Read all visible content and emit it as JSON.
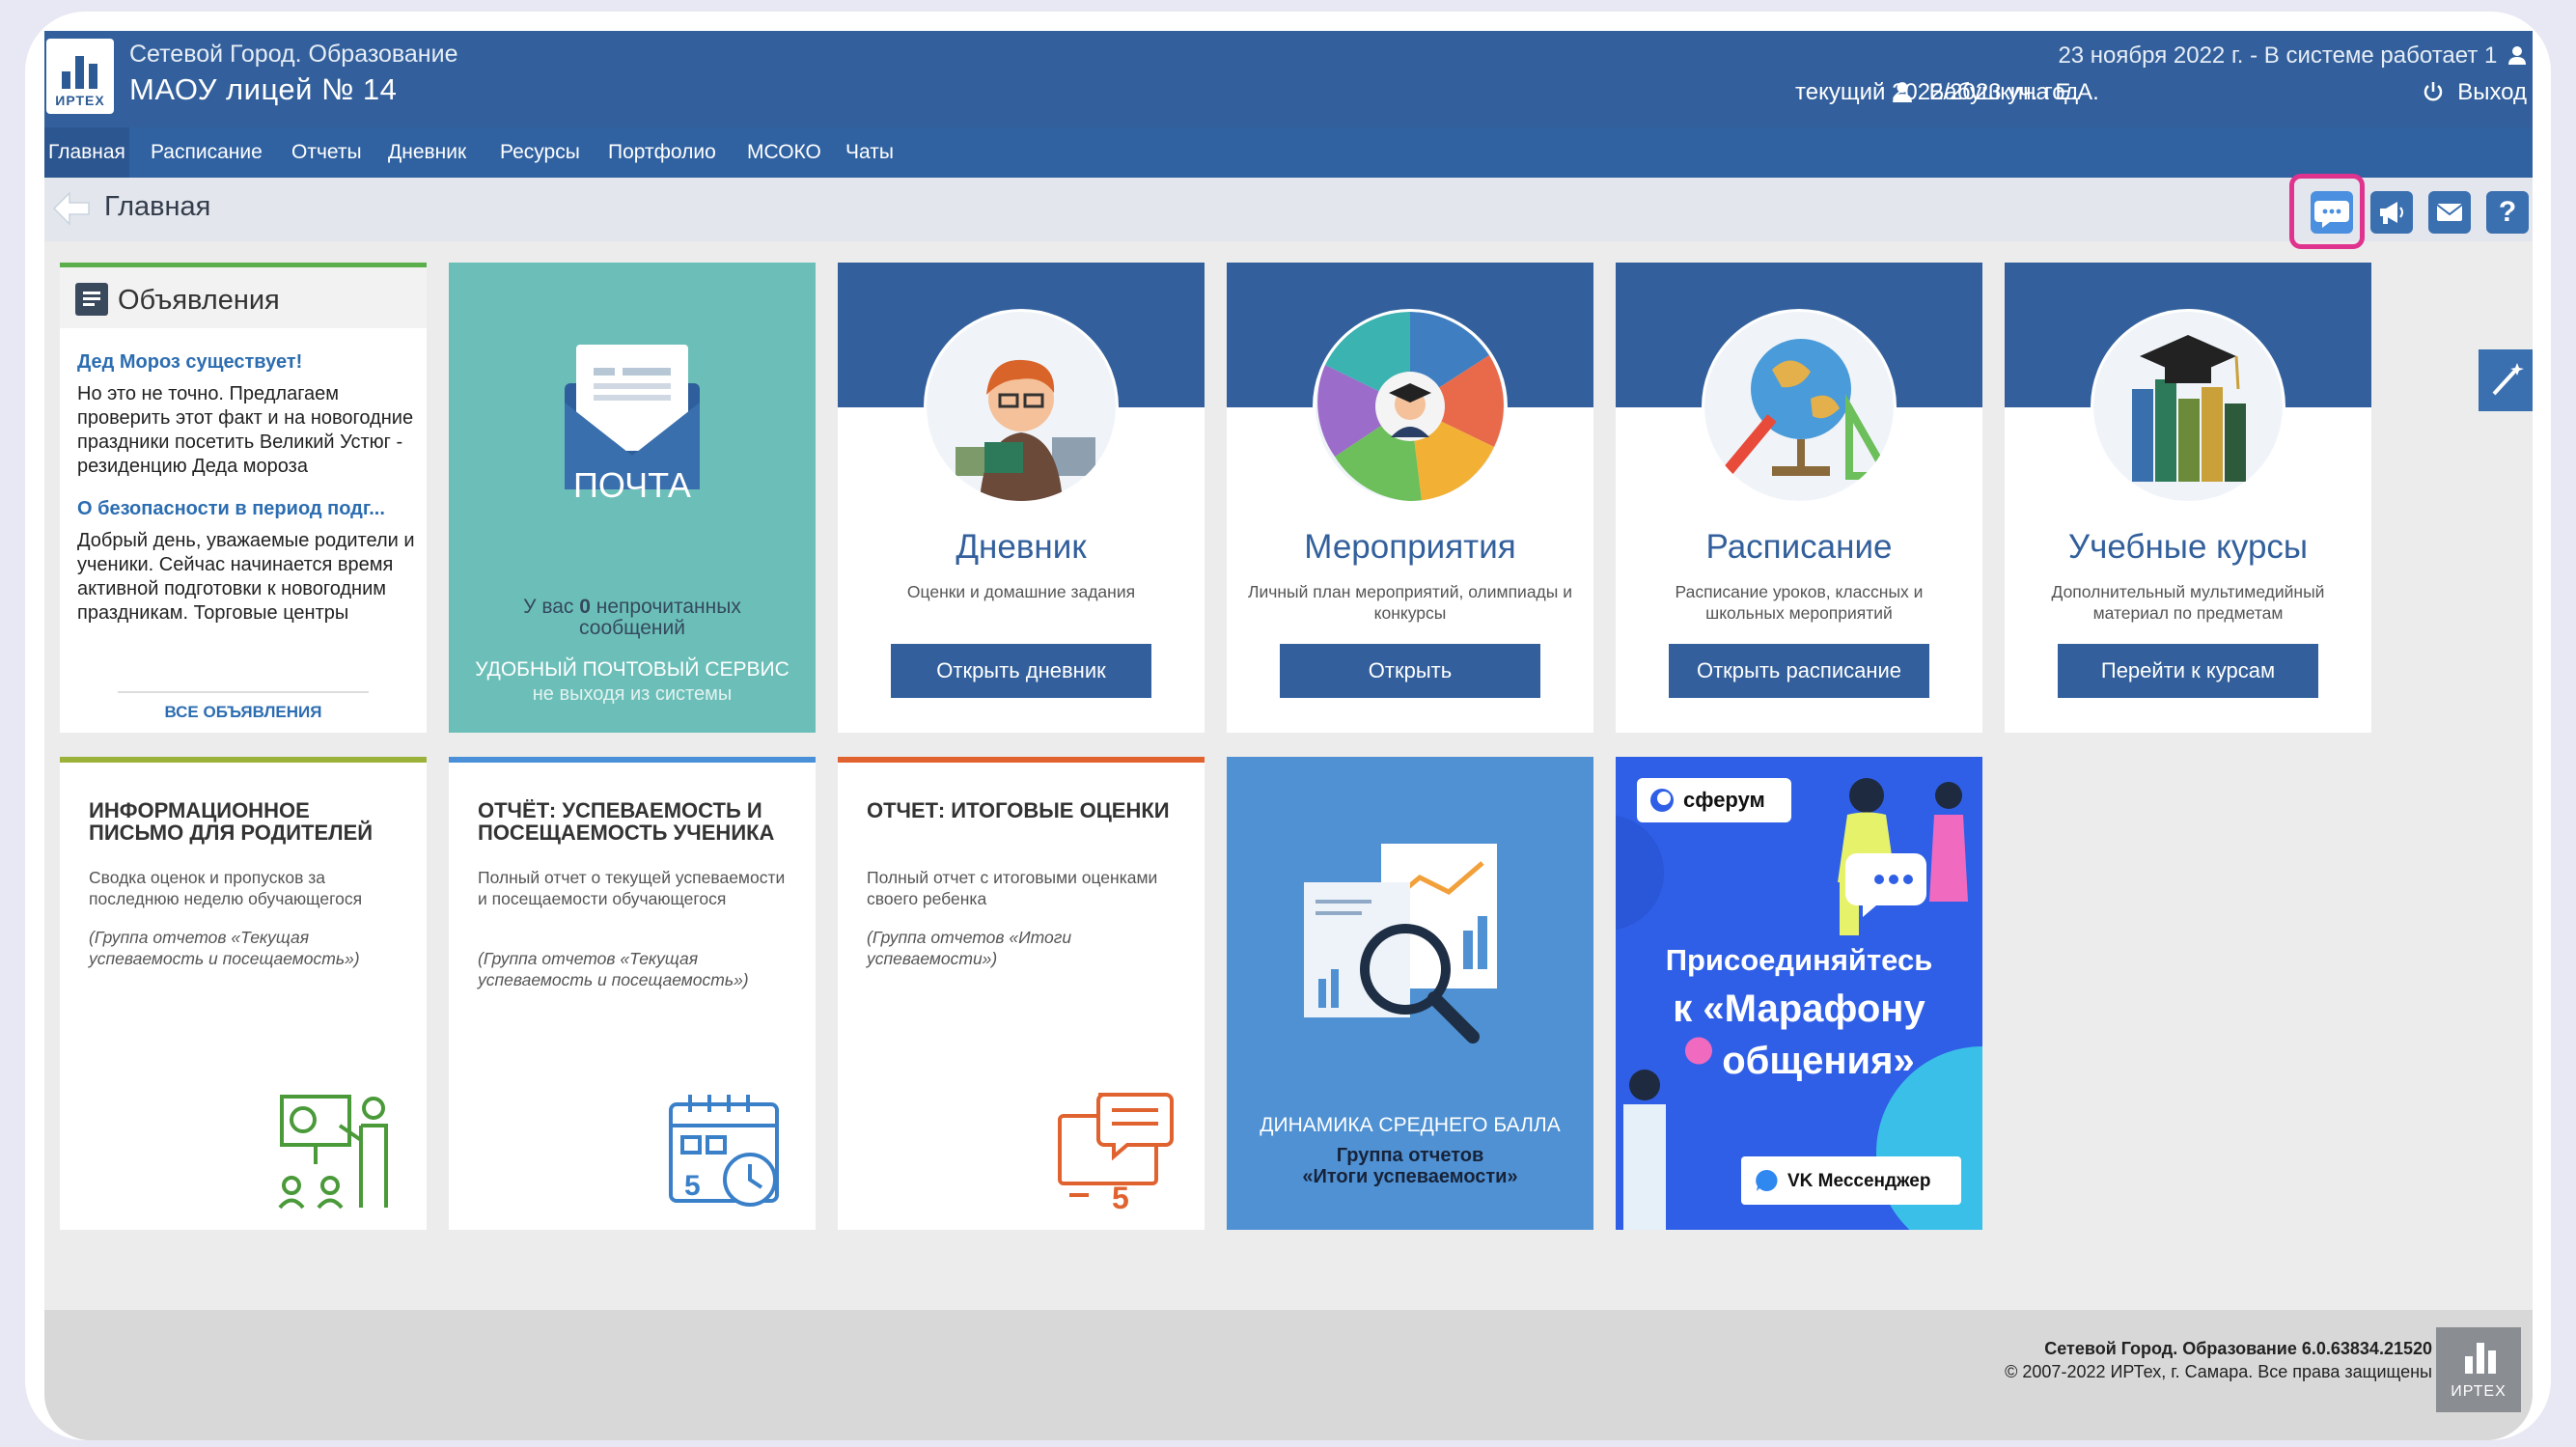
{
  "header": {
    "logo_caption": "ИРТЕХ",
    "subtitle": "Сетевой Город. Образование",
    "org_name": "МАОУ лицей № 14",
    "date_status": "23 ноября 2022 г. - В системе работает 1",
    "school_year": "текущий 2022/2023 уч. год",
    "user_name": "Бабушкина Е.А.",
    "exit_label": "Выход"
  },
  "nav": {
    "items": [
      {
        "label": "Главная",
        "active": true
      },
      {
        "label": "Расписание"
      },
      {
        "label": "Отчеты"
      },
      {
        "label": "Дневник"
      },
      {
        "label": "Ресурсы"
      },
      {
        "label": "Портфолио"
      },
      {
        "label": "МСОКО"
      },
      {
        "label": "Чаты"
      }
    ]
  },
  "breadcrumb": {
    "title": "Главная"
  },
  "toolbar": {
    "buttons": [
      {
        "name": "chat-icon",
        "highlighted": true
      },
      {
        "name": "megaphone-icon"
      },
      {
        "name": "mail-icon"
      },
      {
        "name": "help-icon",
        "label": "?"
      }
    ]
  },
  "ads": {
    "title": "Объявления",
    "items": [
      {
        "title": "Дед Мороз существует!",
        "text": "Но это не точно. Предлагаем проверить этот факт и на новогодние праздники посетить Великий Устюг - резиденцию Деда мороза"
      },
      {
        "title": "О безопасности в период подг...",
        "text": "Добрый день, уважаемые родители и ученики. Сейчас начинается время активной подготовки к новогодним праздникам. Торговые центры"
      }
    ],
    "all_link": "ВСЕ ОБЪЯВЛЕНИЯ"
  },
  "mail": {
    "envelope_label": "ПОЧТА",
    "unread_prefix": "У вас ",
    "unread_count": "0",
    "unread_suffix": " непрочитанных",
    "unread_line2": "сообщений",
    "service_title": "УДОБНЫЙ ПОЧТОВЫЙ СЕРВИС",
    "service_sub": "не выходя из системы",
    "colors": {
      "bg": "#6cbfb8"
    }
  },
  "tiles": [
    {
      "title": "Дневник",
      "desc": "Оценки и домашние задания",
      "button": "Открыть дневник"
    },
    {
      "title": "Мероприятия",
      "desc": "Личный план мероприятий, олимпиады и конкурсы",
      "button": "Открыть"
    },
    {
      "title": "Расписание",
      "desc": "Расписание уроков, классных и школьных мероприятий",
      "button": "Открыть расписание"
    },
    {
      "title": "Учебные курсы",
      "desc": "Дополнительный мультимедийный материал по предметам",
      "button": "Перейти к курсам"
    }
  ],
  "reports": [
    {
      "title": "ИНФОРМАЦИОННОЕ ПИСЬМО ДЛЯ РОДИТЕЛЕЙ",
      "desc": "Сводка оценок и пропусков за последнюю неделю обучающегося",
      "group": "(Группа отчетов «Текущая успеваемость и посещаемость»)",
      "color": "#9bb23a"
    },
    {
      "title": "ОТЧЁТ: УСПЕВАЕМОСТЬ И ПОСЕЩАЕМОСТЬ УЧЕНИКА",
      "desc": "Полный отчет о текущей успеваемости и посещаемости обучающегося",
      "group": "(Группа отчетов «Текущая успеваемость и посещаемость»)",
      "color": "#4a90d9"
    },
    {
      "title": "ОТЧЕТ: ИТОГОВЫЕ ОЦЕНКИ",
      "desc": "Полный отчет с итоговыми оценками своего ребенка",
      "group": "(Группа отчетов «Итоги успеваемости»)",
      "color": "#e0622f"
    }
  ],
  "dynamics": {
    "title": "ДИНАМИКА СРЕДНЕГО БАЛЛА",
    "group_line1": "Группа отчетов",
    "group_line2": "«Итоги успеваемости»"
  },
  "sferum": {
    "brand": "сферум",
    "line1": "Присоединяйтесь",
    "line2": "к «Марафону",
    "line3": "общения»",
    "badge": "VK Мессенджер"
  },
  "footer": {
    "version": "Сетевой Город. Образование 6.0.63834.21520",
    "copyright": "© 2007-2022 ИРТех, г. Самара. Все права защищены",
    "logo_caption": "ИРТЕХ"
  }
}
